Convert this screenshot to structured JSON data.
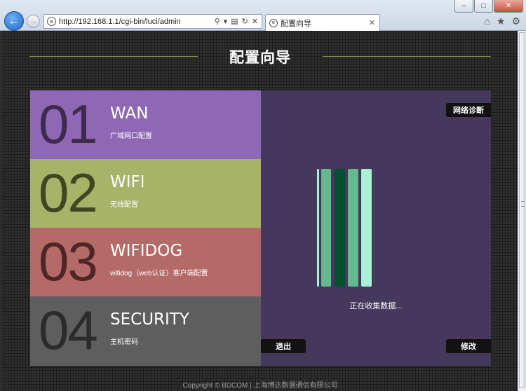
{
  "browser": {
    "url": "http://192.168.1.1/cgi-bin/luci/admin",
    "tab_title": "配置向导",
    "back_glyph": "←",
    "forward_glyph": "→",
    "search_glyph": "⚲",
    "dropdown_glyph": "▾",
    "compat_glyph": "▤",
    "refresh_glyph": "↻",
    "stop_glyph": "✕",
    "tab_close_glyph": "✕",
    "home_glyph": "⌂",
    "favorites_glyph": "★",
    "tools_glyph": "⚙",
    "minimize_glyph": "–",
    "maximize_glyph": "□",
    "close_glyph": "✕"
  },
  "page": {
    "title": "配置向导"
  },
  "menu": [
    {
      "num": "01",
      "name": "WAN",
      "desc": "广域网口配置",
      "bg": "#8f68b5"
    },
    {
      "num": "02",
      "name": "WIFI",
      "desc": "无线配置",
      "bg": "#a8b36a"
    },
    {
      "num": "03",
      "name": "WIFIDOG",
      "desc": "wifidog（web认证）客户端配置",
      "bg": "#b46b68"
    },
    {
      "num": "04",
      "name": "SECURITY",
      "desc": "主机密码",
      "bg": "#5e5e5e"
    }
  ],
  "right_panel": {
    "bg": "#44385c",
    "net_diag_label": "网络诊断",
    "status_text": "正在收集数据...",
    "exit_label": "退出",
    "edit_label": "修改"
  },
  "footer": {
    "text": "Copyright © BDCOM | 上海博达数据通信有限公司"
  }
}
